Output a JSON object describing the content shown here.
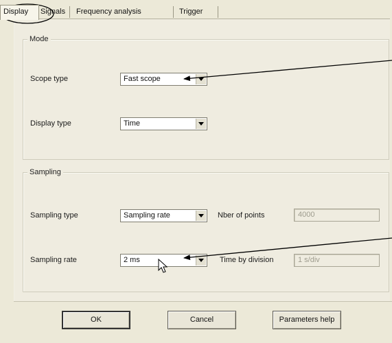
{
  "tabs": [
    {
      "label": "Display",
      "active": true
    },
    {
      "label": "Signals",
      "active": false
    },
    {
      "label": "Frequency analysis",
      "active": false
    },
    {
      "label": "Trigger",
      "active": false
    }
  ],
  "mode": {
    "legend": "Mode",
    "scope_type_label": "Scope type",
    "scope_type_value": "Fast scope",
    "display_type_label": "Display type",
    "display_type_value": "Time"
  },
  "sampling": {
    "legend": "Sampling",
    "sampling_type_label": "Sampling type",
    "sampling_type_value": "Sampling rate",
    "nber_points_label": "Nber of points",
    "nber_points_value": "4000",
    "sampling_rate_label": "Sampling rate",
    "sampling_rate_value": "2 ms",
    "time_by_division_label": "Time by division",
    "time_by_division_value": "1 s/div"
  },
  "buttons": {
    "ok": "OK",
    "cancel": "Cancel",
    "help": "Parameters help"
  },
  "colors": {
    "dialog_bg": "#ece9d8",
    "panel_bg": "#efece0",
    "annotation": "#000000"
  },
  "icons": [
    "dropdown-arrow-icon",
    "mouse-cursor-icon"
  ]
}
